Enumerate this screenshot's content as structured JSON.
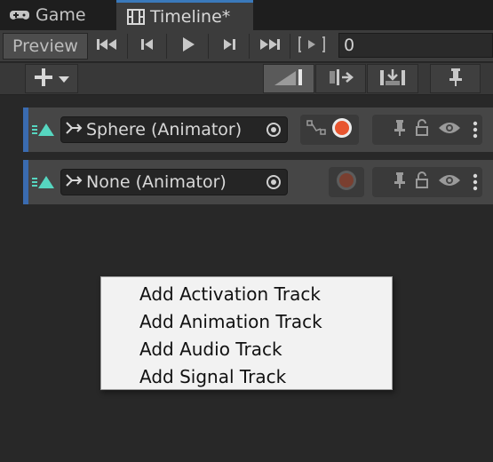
{
  "tabs": [
    {
      "label": "Game",
      "icon": "gamepad-icon"
    },
    {
      "label": "Timeline*",
      "icon": "film-icon"
    }
  ],
  "toolbar": {
    "preview_label": "Preview",
    "frame_value": "0"
  },
  "tracks": [
    {
      "label": "Sphere (Animator)",
      "icons": [
        "activation-icon",
        "animator-icon",
        "target-icon",
        "curves-icon",
        "record-icon",
        "pin-icon",
        "lock-icon",
        "eye-icon",
        "more-icon"
      ]
    },
    {
      "label": "None (Animator)",
      "icons": [
        "activation-icon",
        "animator-icon",
        "target-icon",
        "record-icon",
        "pin-icon",
        "lock-icon",
        "eye-icon",
        "more-icon"
      ]
    }
  ],
  "context_menu": {
    "items": [
      "Add Activation Track",
      "Add Animation Track",
      "Add Audio Track",
      "Add Signal Track"
    ]
  },
  "colors": {
    "accent": "#3a79bb",
    "record": "#e8552f",
    "activation": "#56d6c0"
  }
}
